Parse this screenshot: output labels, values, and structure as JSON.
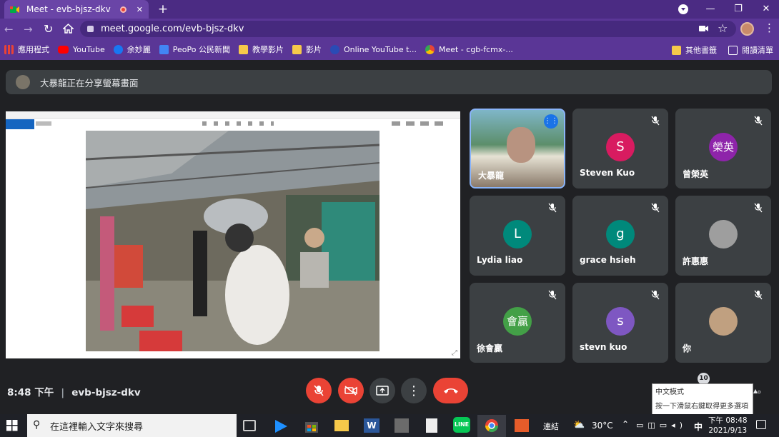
{
  "browser": {
    "tab_title": "Meet - evb-bjsz-dkv",
    "new_tab": "+",
    "url": "meet.google.com/evb-bjsz-dkv",
    "window_controls": [
      "—",
      "❐",
      "✕"
    ]
  },
  "bookmarks": [
    {
      "label": "應用程式",
      "icon": "apps-grid-icon",
      "color": "#ea4335"
    },
    {
      "label": "YouTube",
      "icon": "youtube-icon",
      "color": "#ff0000"
    },
    {
      "label": "余妙麗",
      "icon": "facebook-icon",
      "color": "#1877f2"
    },
    {
      "label": "PeoPo 公民新聞",
      "icon": "peopo-icon",
      "color": "#4285f4"
    },
    {
      "label": "教學影片",
      "icon": "folder-icon",
      "color": "#f6c94a"
    },
    {
      "label": "影片",
      "icon": "folder-icon",
      "color": "#f6c94a"
    },
    {
      "label": "Online YouTube t...",
      "icon": "info-icon",
      "color": "#2a4bb5"
    },
    {
      "label": "Meet - cgb-fcmx-...",
      "icon": "chrome-icon",
      "color": "#34a853"
    }
  ],
  "bookmarks_right": [
    {
      "label": "其他書籤",
      "icon": "folder-icon"
    },
    {
      "label": "閱讀清單",
      "icon": "reading-list-icon"
    }
  ],
  "banner": {
    "text": "大暴龍正在分享螢幕畫面"
  },
  "participants": [
    {
      "name": "大暴龍",
      "initial": "",
      "color": "",
      "speaking": true
    },
    {
      "name": "Steven Kuo",
      "initial": "S",
      "color": "#d81b60",
      "muted": true
    },
    {
      "name": "曾榮英",
      "initial": "榮英",
      "color": "#8e24aa",
      "muted": true
    },
    {
      "name": "Lydia liao",
      "initial": "L",
      "color": "#00897b",
      "muted": true
    },
    {
      "name": "grace hsieh",
      "initial": "g",
      "color": "#00897b",
      "muted": true
    },
    {
      "name": "許惠惠",
      "initial": "",
      "color": "#9e9e9e",
      "muted": true
    },
    {
      "name": "徐會贏",
      "initial": "會贏",
      "color": "#43a047",
      "muted": true
    },
    {
      "name": "stevn kuo",
      "initial": "s",
      "color": "#7e57c2",
      "muted": true
    },
    {
      "name": "你",
      "initial": "",
      "color": "#c0a080",
      "muted": true
    }
  ],
  "controls": {
    "time": "8:48 下午",
    "meeting_code": "evb-bjsz-dkv",
    "colors": {
      "red": "#ea4335",
      "grey": "#3c4043"
    }
  },
  "ime_tooltip": {
    "line1": "中文模式",
    "line2": "按一下滑鼠右鍵取得更多選項",
    "badge": "10"
  },
  "taskbar": {
    "search_placeholder": "在這裡輸入文字來搜尋",
    "connect": "連結",
    "weather": "30°C",
    "ime": "中",
    "time": "下午 08:48",
    "date": "2021/9/13"
  }
}
